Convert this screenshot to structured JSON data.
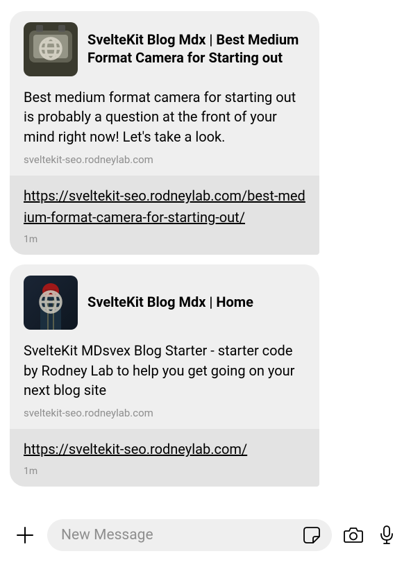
{
  "messages": [
    {
      "title": "SvelteKit Blog Mdx | Best Medium Format Camera for Starting out",
      "description": "Best medium format camera for starting out is probably a question at the front of your mind right now! Let's take a look.",
      "domain": "sveltekit-seo.rodneylab.com",
      "url": "https://sveltekit-seo.rodneylab.com/best-medium-format-camera-for-starting-out/",
      "timestamp": "1m"
    },
    {
      "title": "SvelteKit Blog Mdx | Home",
      "description": "SvelteKit MDsvex Blog Starter - starter code by Rodney Lab to help you get going on your next blog site",
      "domain": "sveltekit-seo.rodneylab.com",
      "url": "https://sveltekit-seo.rodneylab.com/",
      "timestamp": "1m"
    }
  ],
  "composer": {
    "placeholder": "New Message"
  }
}
